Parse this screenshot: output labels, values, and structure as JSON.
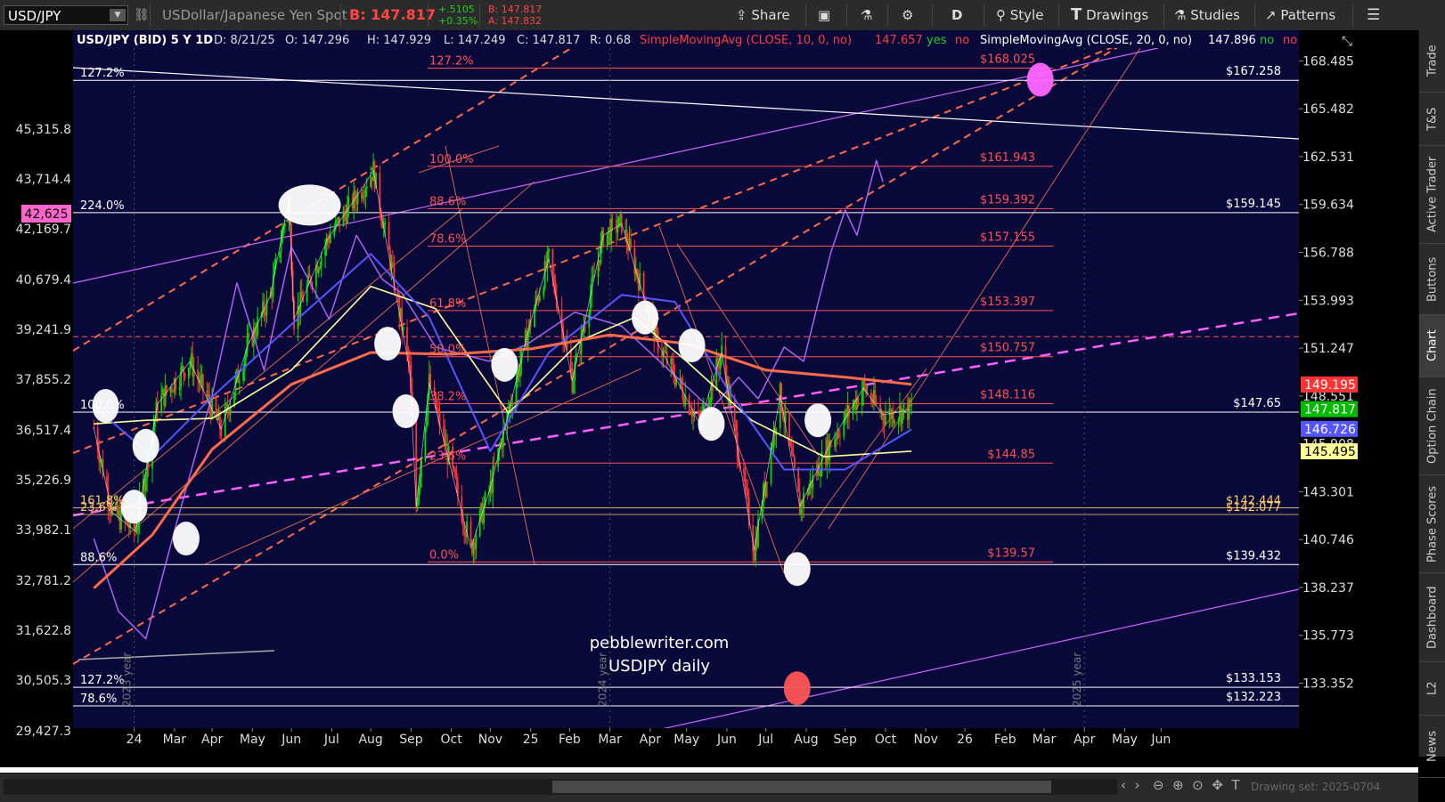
{
  "toolbar": {
    "symbol": "USD/JPY",
    "description": "USDollar/Japanese Yen Spot",
    "bid": "B: 147.817",
    "change_pts": "+.5105",
    "change_pct": "+0.35%",
    "bid_small": "B: 147.817",
    "ask_small": "A: 147.832",
    "share": "Share",
    "period": "D",
    "style": "Style",
    "drawings": "Drawings",
    "studies": "Studies",
    "patterns": "Patterns"
  },
  "header": {
    "title": "USD/JPY (BID) 5 Y 1D",
    "date": "D: 8/21/25",
    "open": "O: 147.296",
    "high": "H: 147.929",
    "low": "L: 147.249",
    "close": "C: 147.817",
    "range": "R: 0.68",
    "sma10": "SimpleMovingAvg (CLOSE, 10, 0, no)",
    "sma10_val": "147.657",
    "yes": "yes",
    "no": "no",
    "sma20": "SimpleMovingAvg (CLOSE, 20, 0, no)",
    "sma20_val": "147.896"
  },
  "watermark": {
    "line1": "pebblewriter.com",
    "line2": "USDJPY daily"
  },
  "colors": {
    "bg": "#0a0a3a",
    "fib_red": "#ff5050",
    "magenta": "#cc66ff",
    "pink_line": "#ff60ff",
    "white": "#ffffff",
    "green": "#00dd00",
    "red": "#ff3333",
    "blue_ma": "#5555ff",
    "yellow_ma": "#ffff99",
    "orange_ma": "#ff6a4a"
  },
  "chart_data": {
    "type": "candlestick",
    "x_tick_labels": [
      "24",
      "Mar",
      "Apr",
      "May",
      "Jun",
      "Jul",
      "Aug",
      "Sep",
      "Oct",
      "Nov",
      "25",
      "Feb",
      "Mar",
      "Apr",
      "May",
      "Jun",
      "Jul",
      "Aug",
      "Sep",
      "Oct",
      "Nov",
      "26",
      "Feb",
      "Mar",
      "Apr",
      "May",
      "Jun"
    ],
    "year_labels": [
      "2023 year",
      "2024 year",
      "2025 year"
    ],
    "right_axis_ticks": [
      "168.485",
      "165.482",
      "162.531",
      "159.634",
      "156.788",
      "153.993",
      "151.247",
      "148.551",
      "145.908",
      "143.301",
      "140.746",
      "138.237",
      "135.773",
      "133.352"
    ],
    "left_axis_ticks": [
      "45,315.8",
      "43,714.4",
      "42,169.7",
      "40,679.4",
      "39,241.9",
      "37,855.2",
      "36,517.4",
      "35,226.9",
      "33,982.1",
      "32,781.2",
      "31,622.8",
      "30,505.3",
      "29,427.3"
    ],
    "left_axis_marker": "42,625",
    "price_tags": [
      {
        "value": "149.195",
        "color": "#ff3333"
      },
      {
        "value": "147.817",
        "color": "#00bb00"
      },
      {
        "value": "146.726",
        "color": "#5555ff"
      },
      {
        "value": "145.495",
        "color": "#ffff99"
      }
    ],
    "fib_levels": [
      {
        "label": "127.2%",
        "price_label": "$168.025",
        "price": 168.03
      },
      {
        "label": "100.0%",
        "price_label": "$161.943",
        "price": 161.94
      },
      {
        "label": "88.6%",
        "price_label": "$159.392",
        "price": 159.39
      },
      {
        "label": "78.6%",
        "price_label": "$157.155",
        "price": 157.16
      },
      {
        "label": "61.8%",
        "price_label": "$153.397",
        "price": 153.4
      },
      {
        "label": "50.0%",
        "price_label": "$150.757",
        "price": 150.76
      },
      {
        "label": "38.2%",
        "price_label": "$148.116",
        "price": 148.12
      },
      {
        "label": "23.6%",
        "price_label": "$144.85",
        "price": 144.85
      },
      {
        "label": "0.0%",
        "price_label": "$139.57",
        "price": 139.57
      }
    ],
    "white_levels": [
      {
        "label": "127.2%",
        "price_label": "$167.258",
        "price": 167.26
      },
      {
        "label": "224.0%",
        "price_label": "$159.145",
        "price": 159.15
      },
      {
        "label": "100.0%",
        "price_label": "$147.65",
        "price": 147.65
      },
      {
        "label": "88.6%",
        "price_label": "$139.432",
        "price": 139.43
      },
      {
        "label": "127.2%",
        "price_label": "$133.153",
        "price": 133.15
      },
      {
        "label": "78.6%",
        "price_label": "$132.223",
        "price": 132.22
      }
    ],
    "extra_levels": [
      {
        "label": "161.8%",
        "price_label": "$142.444",
        "price": 142.44
      },
      {
        "label": "23.6%",
        "price_label": "$142.077",
        "price": 142.08
      }
    ],
    "close_path": [
      [
        "2023-12-01",
        146.8
      ],
      [
        "2023-12-15",
        142.2
      ],
      [
        "2024-01-02",
        141.2
      ],
      [
        "2024-01-19",
        148.1
      ],
      [
        "2024-02-13",
        150.5
      ],
      [
        "2024-03-08",
        146.7
      ],
      [
        "2024-03-28",
        151.3
      ],
      [
        "2024-04-15",
        154.3
      ],
      [
        "2024-04-29",
        160.0
      ],
      [
        "2024-05-03",
        152.9
      ],
      [
        "2024-05-29",
        157.6
      ],
      [
        "2024-06-26",
        160.8
      ],
      [
        "2024-07-03",
        161.7
      ],
      [
        "2024-07-31",
        150.0
      ],
      [
        "2024-08-05",
        142.5
      ],
      [
        "2024-08-15",
        149.3
      ],
      [
        "2024-09-16",
        140.3
      ],
      [
        "2024-10-01",
        143.5
      ],
      [
        "2024-10-31",
        152.5
      ],
      [
        "2024-11-15",
        156.4
      ],
      [
        "2024-12-03",
        149.4
      ],
      [
        "2024-12-27",
        157.8
      ],
      [
        "2025-01-10",
        158.5
      ],
      [
        "2025-02-07",
        151.5
      ],
      [
        "2025-03-11",
        147.0
      ],
      [
        "2025-03-28",
        151.0
      ],
      [
        "2025-04-22",
        140.2
      ],
      [
        "2025-05-12",
        148.6
      ],
      [
        "2025-05-27",
        142.5
      ],
      [
        "2025-06-20",
        146.0
      ],
      [
        "2025-07-15",
        149.0
      ],
      [
        "2025-07-30",
        147.5
      ],
      [
        "2025-08-21",
        147.8
      ]
    ],
    "sma_red": [
      [
        "2023-12-01",
        138.2
      ],
      [
        "2024-01-15",
        141.0
      ],
      [
        "2024-03-01",
        145.6
      ],
      [
        "2024-05-01",
        149.2
      ],
      [
        "2024-07-01",
        151.0
      ],
      [
        "2024-09-01",
        150.9
      ],
      [
        "2024-11-01",
        151.2
      ],
      [
        "2025-01-01",
        152.0
      ],
      [
        "2025-03-01",
        151.5
      ],
      [
        "2025-05-01",
        150.0
      ],
      [
        "2025-07-01",
        149.6
      ],
      [
        "2025-08-21",
        149.2
      ]
    ],
    "sma_blue": [
      [
        "2023-12-01",
        148.0
      ],
      [
        "2024-01-15",
        145.2
      ],
      [
        "2024-03-01",
        148.5
      ],
      [
        "2024-05-01",
        152.6
      ],
      [
        "2024-07-01",
        156.7
      ],
      [
        "2024-08-15",
        153.0
      ],
      [
        "2024-10-01",
        145.5
      ],
      [
        "2024-11-15",
        151.0
      ],
      [
        "2025-01-10",
        154.3
      ],
      [
        "2025-02-20",
        153.9
      ],
      [
        "2025-04-01",
        149.0
      ],
      [
        "2025-05-15",
        144.5
      ],
      [
        "2025-07-01",
        144.5
      ],
      [
        "2025-08-21",
        146.7
      ]
    ],
    "sma_yellow": [
      [
        "2023-12-01",
        147.0
      ],
      [
        "2024-01-10",
        147.2
      ],
      [
        "2024-03-01",
        147.3
      ],
      [
        "2024-05-01",
        150.0
      ],
      [
        "2024-07-01",
        154.8
      ],
      [
        "2024-08-20",
        153.5
      ],
      [
        "2024-10-15",
        147.6
      ],
      [
        "2024-12-10",
        151.7
      ],
      [
        "2025-01-20",
        153.0
      ],
      [
        "2025-03-01",
        150.5
      ],
      [
        "2025-04-20",
        147.2
      ],
      [
        "2025-06-15",
        145.2
      ],
      [
        "2025-08-21",
        145.5
      ]
    ],
    "purple_overlay": [
      [
        "2023-12-01",
        140.8
      ],
      [
        "2023-12-20",
        137.0
      ],
      [
        "2024-01-10",
        135.6
      ],
      [
        "2024-02-01",
        141.2
      ],
      [
        "2024-03-01",
        148.6
      ],
      [
        "2024-03-20",
        155.0
      ],
      [
        "2024-04-10",
        150.0
      ],
      [
        "2024-05-01",
        157.1
      ],
      [
        "2024-05-30",
        152.9
      ],
      [
        "2024-06-20",
        157.8
      ],
      [
        "2024-07-10",
        155.2
      ],
      [
        "2024-07-25",
        154.4
      ],
      [
        "2024-08-20",
        151.3
      ],
      [
        "2024-09-30",
        150.5
      ],
      [
        "2024-10-30",
        151.5
      ],
      [
        "2024-12-05",
        153.3
      ],
      [
        "2025-01-10",
        152.5
      ],
      [
        "2025-03-20",
        147.8
      ],
      [
        "2025-04-10",
        149.6
      ],
      [
        "2025-04-25",
        148.4
      ],
      [
        "2025-05-15",
        151.3
      ],
      [
        "2025-05-30",
        150.5
      ],
      [
        "2025-06-10",
        153.8
      ],
      [
        "2025-06-20",
        156.8
      ],
      [
        "2025-07-01",
        159.3
      ],
      [
        "2025-07-10",
        157.8
      ],
      [
        "2025-07-25",
        162.3
      ],
      [
        "2025-07-30",
        161.0
      ]
    ],
    "highlight_circles": [
      [
        "2024-05-15",
        159.6,
        "white"
      ],
      [
        "2023-12-10",
        148.0,
        "white"
      ],
      [
        "2024-01-10",
        145.8,
        "white"
      ],
      [
        "2024-01-01",
        142.5,
        "white"
      ],
      [
        "2024-02-10",
        140.8,
        "white"
      ],
      [
        "2024-07-14",
        151.5,
        "white"
      ],
      [
        "2024-07-28",
        147.7,
        "white"
      ],
      [
        "2024-10-12",
        150.3,
        "white"
      ],
      [
        "2025-01-28",
        153.0,
        "white"
      ],
      [
        "2025-03-05",
        151.4,
        "white"
      ],
      [
        "2025-03-20",
        147.0,
        "white"
      ],
      [
        "2025-05-25",
        139.2,
        "white"
      ],
      [
        "2025-06-10",
        147.2,
        "white"
      ],
      [
        "2025-11-28",
        167.3,
        "magenta"
      ],
      [
        "2025-05-25",
        133.1,
        "red"
      ]
    ],
    "y_scale": "log",
    "ylim": [
      132.0,
      169.3
    ],
    "grid": false,
    "legend": "none"
  },
  "right_panel": {
    "tabs": [
      "Trade",
      "T&S",
      "Active Trader",
      "Buttons",
      "Chart",
      "Option Chain",
      "Phase Scores",
      "Dashboard",
      "L2",
      "News"
    ],
    "active": "Chart"
  },
  "bottom": {
    "drawing_set": "Drawing set: 2025-0704"
  }
}
